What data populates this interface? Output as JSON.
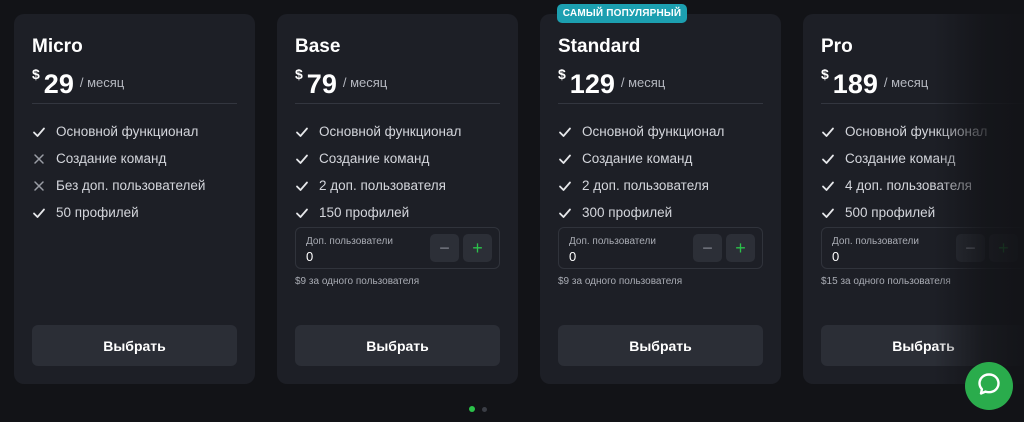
{
  "badge": {
    "popular": "САМЫЙ ПОПУЛЯРНЫЙ"
  },
  "colors": {
    "accent_green": "#2bc24a",
    "badge_teal": "#1c9fb0",
    "card_bg": "#1d1f26",
    "page_bg": "#121317"
  },
  "icons": {
    "included": "check-icon",
    "excluded": "cross-icon",
    "chat": "chat-icon"
  },
  "plans": [
    {
      "name": "Micro",
      "currency": "$",
      "amount": "29",
      "period": "/ месяц",
      "features": [
        {
          "text": "Основной функционал",
          "included": true
        },
        {
          "text": "Создание команд",
          "included": false
        },
        {
          "text": "Без доп. пользователей",
          "included": false
        },
        {
          "text": "50 профилей",
          "included": true
        }
      ],
      "button": "Выбрать"
    },
    {
      "name": "Base",
      "currency": "$",
      "amount": "79",
      "period": "/ месяц",
      "features": [
        {
          "text": "Основной функционал",
          "included": true
        },
        {
          "text": "Создание команд",
          "included": true
        },
        {
          "text": "2 доп. пользователя",
          "included": true
        },
        {
          "text": "150 профилей",
          "included": true
        }
      ],
      "stepper_label": "Доп. пользователи",
      "stepper_value": "0",
      "unit_price": "$9 за одного пользователя",
      "button": "Выбрать"
    },
    {
      "name": "Standard",
      "currency": "$",
      "amount": "129",
      "period": "/ месяц",
      "features": [
        {
          "text": "Основной функционал",
          "included": true
        },
        {
          "text": "Создание команд",
          "included": true
        },
        {
          "text": "2 доп. пользователя",
          "included": true
        },
        {
          "text": "300 профилей",
          "included": true
        }
      ],
      "stepper_label": "Доп. пользователи",
      "stepper_value": "0",
      "unit_price": "$9 за одного пользователя",
      "button": "Выбрать"
    },
    {
      "name": "Pro",
      "currency": "$",
      "amount": "189",
      "period": "/ месяц",
      "features": [
        {
          "text": "Основной функционал",
          "included": true
        },
        {
          "text": "Создание команд",
          "included": true
        },
        {
          "text": "4 доп. пользователя",
          "included": true
        },
        {
          "text": "500 профилей",
          "included": true
        }
      ],
      "stepper_label": "Доп. пользователи",
      "stepper_value": "0",
      "unit_price": "$15 за одного пользователя",
      "button": "Выбрать"
    }
  ],
  "stepper_buttons": {
    "minus": "−",
    "plus": "+"
  },
  "pagination": {
    "current": 1,
    "total": 2
  }
}
